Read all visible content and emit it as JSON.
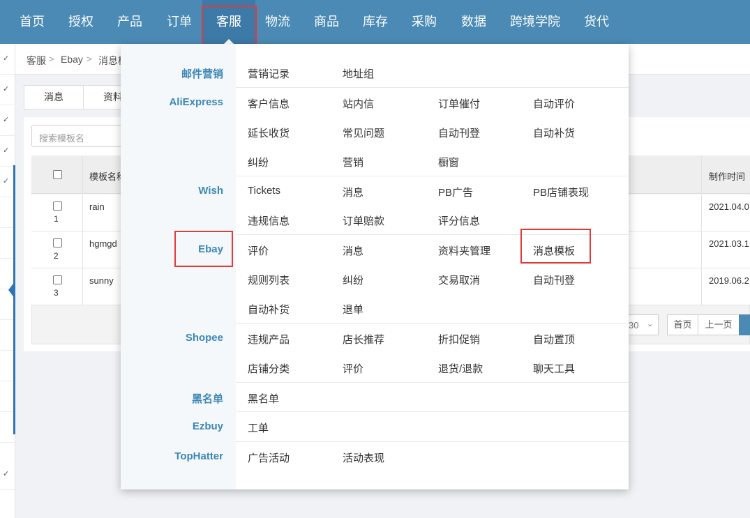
{
  "nav": {
    "items": [
      "首页",
      "授权",
      "产品",
      "订单",
      "客服",
      "物流",
      "商品",
      "库存",
      "采购",
      "数据",
      "跨境学院",
      "货代"
    ],
    "active": "客服",
    "bg_color": "#4a8ab5"
  },
  "breadcrumb": {
    "items": [
      "客服",
      "Ebay",
      "消息模"
    ]
  },
  "tabs": [
    "消息",
    "资料"
  ],
  "search": {
    "placeholder": "搜索模板名"
  },
  "table": {
    "headers": {
      "name": "模板名称",
      "created": "制作时间"
    },
    "rows": [
      {
        "index": "1",
        "name": "rain",
        "created": "2021.04.0"
      },
      {
        "index": "2",
        "name": "hgmgd",
        "created": "2021.03.1"
      },
      {
        "index": "3",
        "name": "sunny",
        "created": "2019.06.2"
      }
    ]
  },
  "pager": {
    "page_size": "30",
    "first": "首页",
    "prev": "上一页"
  },
  "menu": {
    "categories": [
      {
        "name": "邮件营销",
        "items": [
          "营销记录",
          "地址组"
        ]
      },
      {
        "name": "AliExpress",
        "items": [
          "客户信息",
          "站内信",
          "订单催付",
          "自动评价",
          "延长收货",
          "常见问题",
          "自动刊登",
          "自动补货",
          "纠纷",
          "营销",
          "橱窗"
        ]
      },
      {
        "name": "Wish",
        "items": [
          "Tickets",
          "消息",
          "PB广告",
          "PB店铺表现",
          "违规信息",
          "订单赔款",
          "评分信息"
        ]
      },
      {
        "name": "Ebay",
        "items": [
          "评价",
          "消息",
          "资料夹管理",
          "消息模板",
          "规则列表",
          "纠纷",
          "交易取消",
          "自动刊登",
          "自动补货",
          "退单"
        ]
      },
      {
        "name": "Shopee",
        "items": [
          "违规产品",
          "店长推荐",
          "折扣促销",
          "自动置顶",
          "店铺分类",
          "评价",
          "退货/退款",
          "聊天工具"
        ]
      },
      {
        "name": "黑名单",
        "items": [
          "黑名单"
        ]
      },
      {
        "name": "Ezbuy",
        "items": [
          "工单"
        ]
      },
      {
        "name": "TopHatter",
        "items": [
          "广告活动",
          "活动表现"
        ]
      }
    ],
    "accent_color": "#3c87b7",
    "highlight_color": "#e03a3a"
  }
}
